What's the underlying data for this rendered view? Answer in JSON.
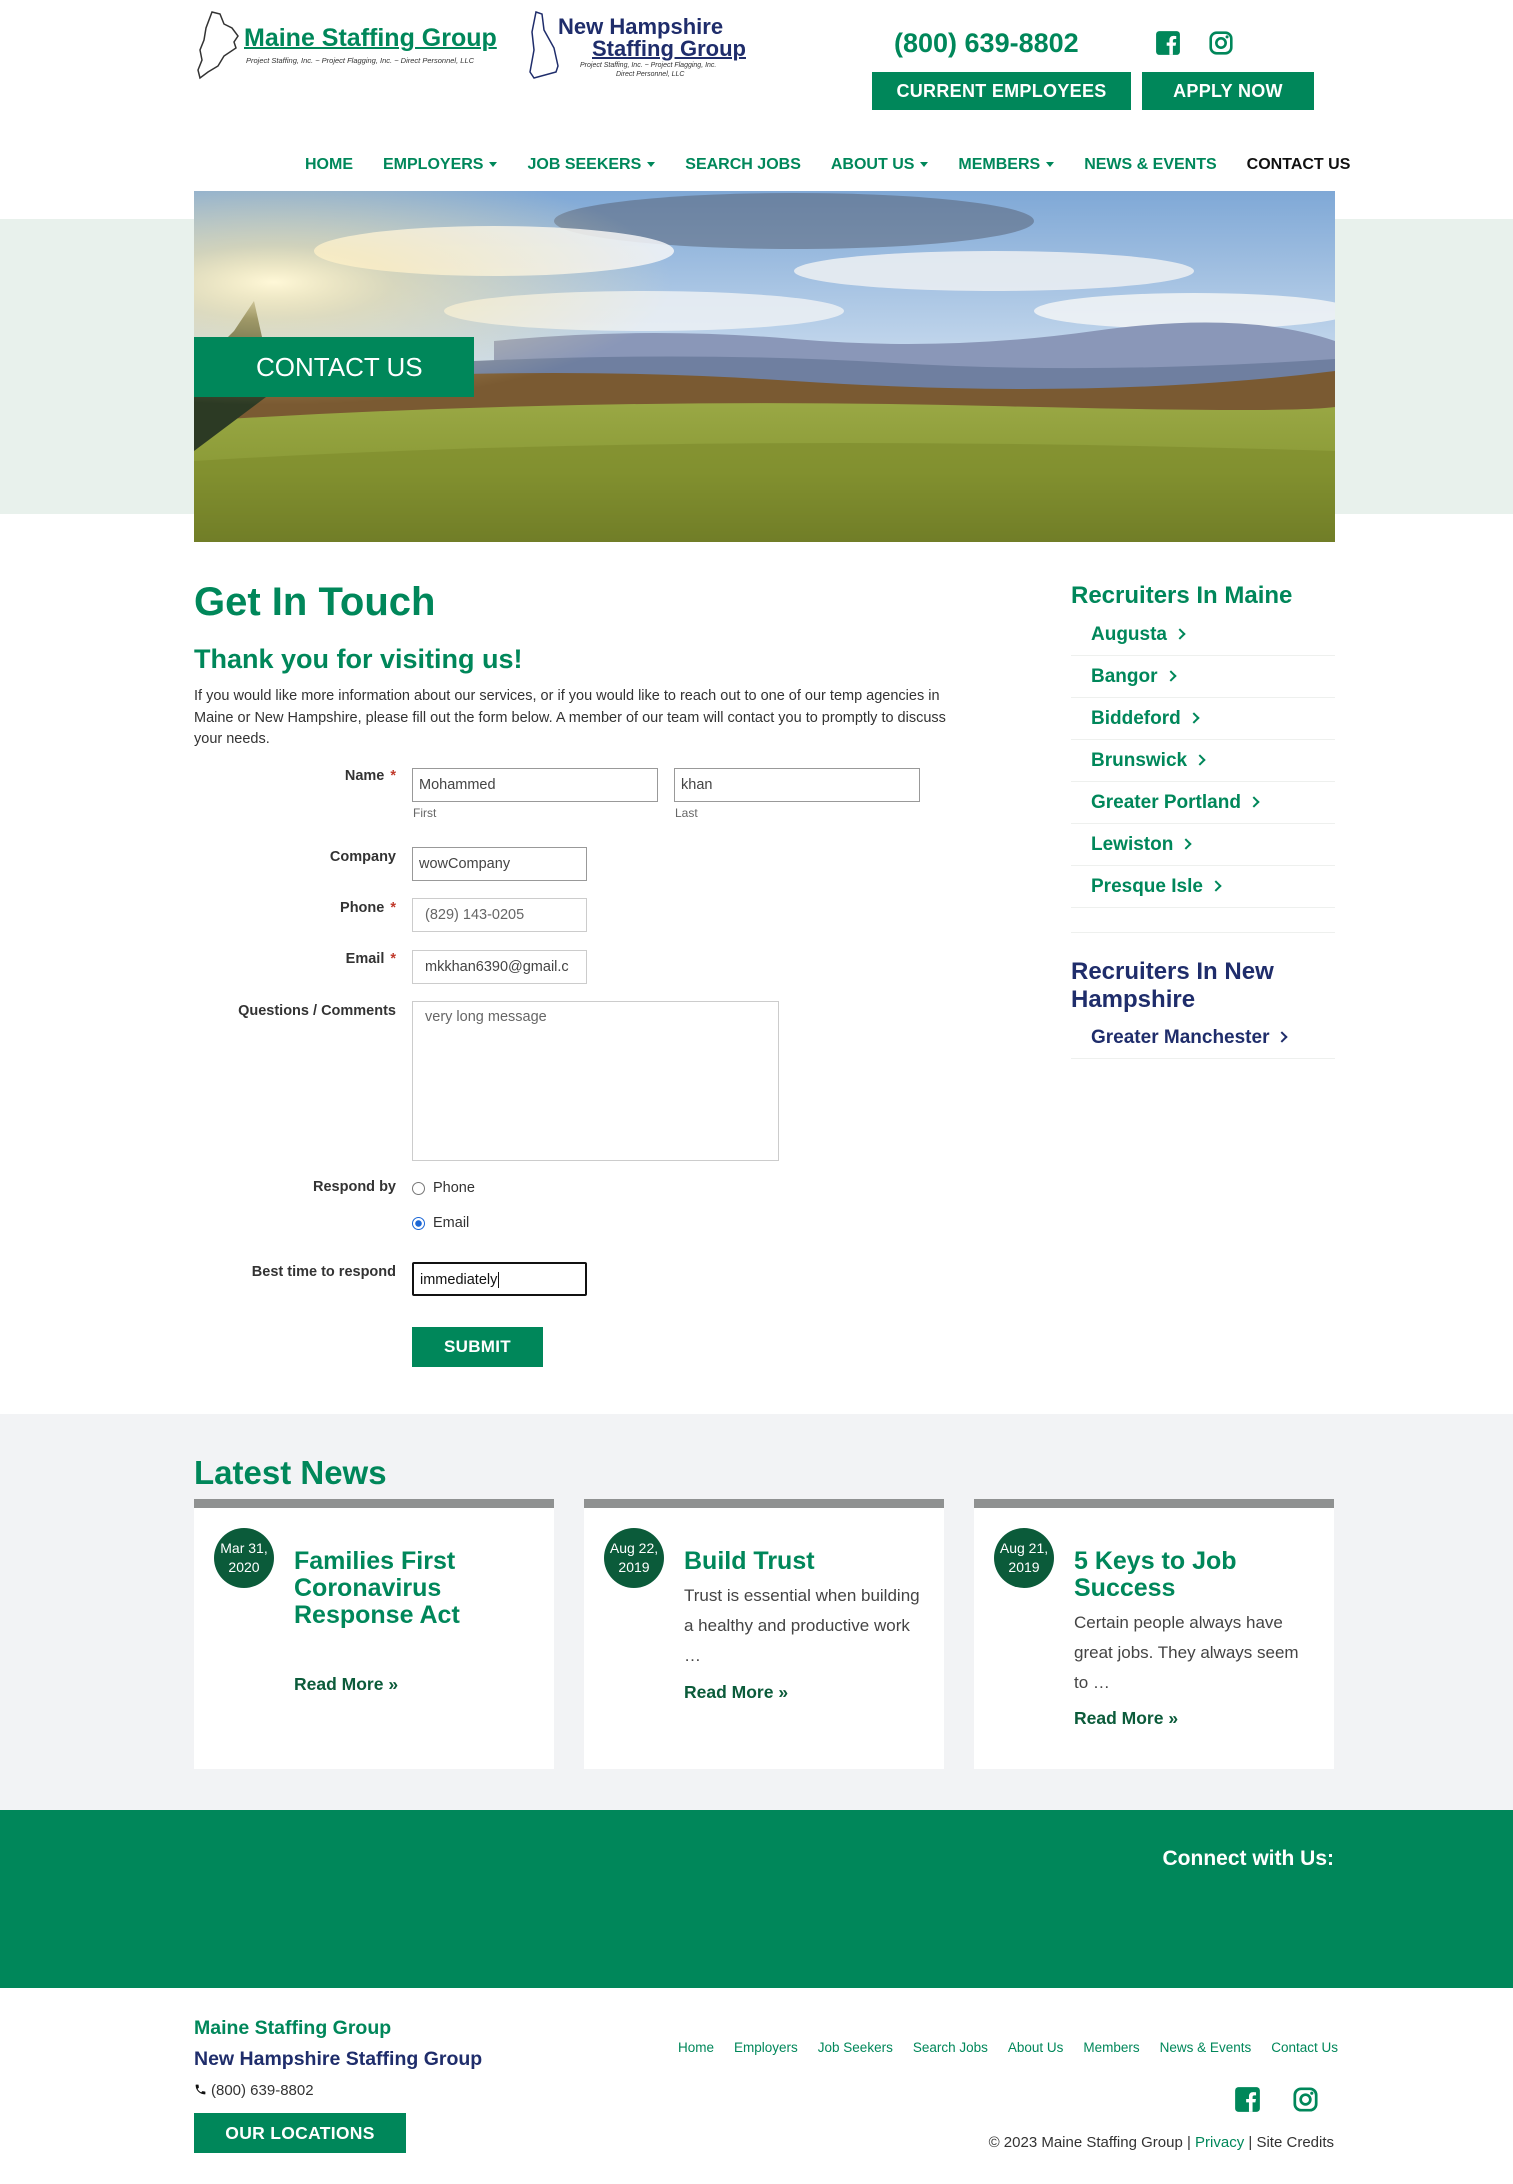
{
  "header": {
    "maine_logo_title": "Maine Staffing Group",
    "maine_logo_sub": "Project Staffing, Inc. ~ Project Flagging, Inc. ~ Direct Personnel, LLC",
    "nh_logo_title_1": "New Hampshire",
    "nh_logo_title_2": "Staffing Group",
    "nh_logo_sub_1": "Project Staffing, Inc. ~ Project Flagging, Inc.",
    "nh_logo_sub_2": "Direct Personnel, LLC",
    "phone": "(800) 639-8802",
    "current_employees": "CURRENT EMPLOYEES",
    "apply_now": "APPLY NOW"
  },
  "nav": {
    "home": "HOME",
    "employers": "EMPLOYERS",
    "job_seekers": "JOB SEEKERS",
    "search_jobs": "SEARCH JOBS",
    "about_us": "ABOUT US",
    "members": "MEMBERS",
    "news_events": "NEWS & EVENTS",
    "contact_us": "CONTACT US"
  },
  "hero": {
    "title": "CONTACT US"
  },
  "main": {
    "heading": "Get In Touch",
    "subheading": "Thank you for visiting us!",
    "intro": "If you would like more information about our services, or if you would like to reach out to one of our temp agencies in Maine or New Hampshire, please fill out the form below. A member of our team will contact you to promptly to discuss your needs."
  },
  "form": {
    "name_label": "Name",
    "first_value": "Mohammed",
    "first_sub": "First",
    "last_value": "khan",
    "last_sub": "Last",
    "company_label": "Company",
    "company_value": "wowCompany",
    "phone_label": "Phone",
    "phone_placeholder": "(829) 143-0205",
    "email_label": "Email",
    "email_value": "mkkhan6390@gmail.c",
    "comments_label": "Questions / Comments",
    "comments_placeholder": "very long message",
    "respond_label": "Respond by",
    "respond_phone": "Phone",
    "respond_email": "Email",
    "respond_selected": "Email",
    "best_time_label": "Best time to respond",
    "best_time_value": "immediately",
    "required_mark": "*",
    "submit": "SUBMIT"
  },
  "sidebar": {
    "maine_heading": "Recruiters In Maine",
    "maine_items": [
      "Augusta",
      "Bangor",
      "Biddeford",
      "Brunswick",
      "Greater Portland",
      "Lewiston",
      "Presque Isle"
    ],
    "nh_heading": "Recruiters In New Hampshire",
    "nh_items": [
      "Greater Manchester"
    ]
  },
  "news": {
    "heading": "Latest News",
    "cards": [
      {
        "date_1": "Mar 31,",
        "date_2": "2020",
        "title": "Families First Coronavirus Response Act",
        "excerpt": "",
        "more": "Read More »"
      },
      {
        "date_1": "Aug 22,",
        "date_2": "2019",
        "title": "Build Trust",
        "excerpt": "Trust is essential when building a healthy and productive work …",
        "more": "Read More »"
      },
      {
        "date_1": "Aug 21,",
        "date_2": "2019",
        "title": "5 Keys to Job Success",
        "excerpt": "Certain people always have great jobs. They always seem to …",
        "more": "Read More »"
      }
    ]
  },
  "connect": {
    "title": "Connect with Us:"
  },
  "footer": {
    "maine": "Maine Staffing Group",
    "nh": "New Hampshire Staffing Group",
    "phone": "(800) 639-8802",
    "locations": "OUR LOCATIONS",
    "links": [
      "Home",
      "Employers",
      "Job Seekers",
      "Search Jobs",
      "About Us",
      "Members",
      "News & Events",
      "Contact Us"
    ],
    "copyright": "© 2023 Maine Staffing Group |",
    "privacy": "Privacy",
    "credits": "| Site Credits"
  },
  "colors": {
    "brand_green": "#00875a",
    "dark_green": "#0b5b3a",
    "navy": "#1f2d6b",
    "news_bg": "#f2f3f5"
  },
  "icons": [
    "facebook-icon",
    "instagram-icon",
    "phone-icon",
    "chevron-right-icon",
    "caret-down-icon",
    "maine-state-outline-icon",
    "new-hampshire-state-outline-icon"
  ]
}
